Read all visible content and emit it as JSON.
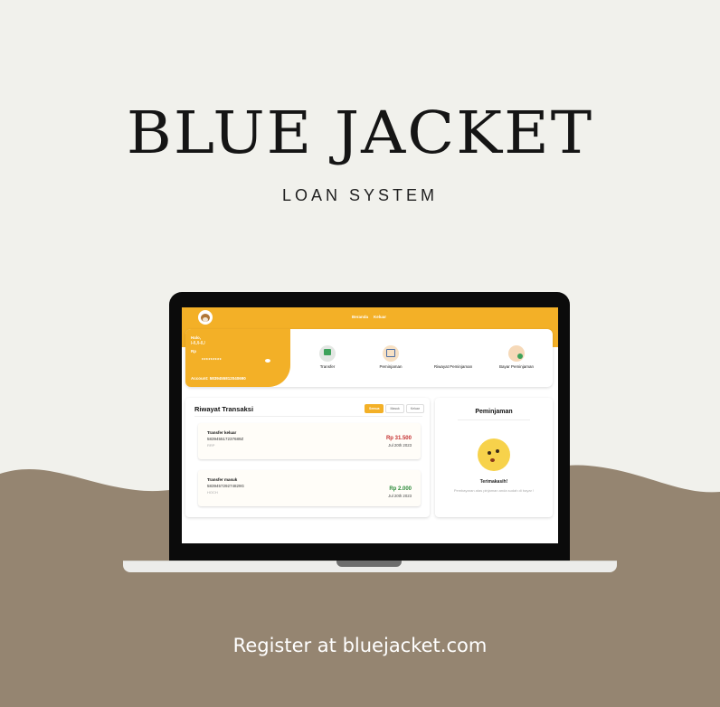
{
  "poster": {
    "title": "BLUE JACKET",
    "subtitle": "LOAN SYSTEM",
    "register": "Register at bluejacket.com",
    "colors": {
      "background": "#f1f1ec",
      "wave": "#958571",
      "accent": "#f3b027"
    }
  },
  "app": {
    "nav": {
      "item1": "Beranda",
      "item2": "Keluar"
    },
    "balance": {
      "greeting": "Halo,",
      "name": "HUHU",
      "currency": "Rp",
      "masked": "*********",
      "account": "Account: 5839455812040690"
    },
    "menu": [
      {
        "label": "Transfer",
        "icon": "money-icon"
      },
      {
        "label": "Peminjaman",
        "icon": "phone-icon"
      },
      {
        "label": "Riwayat Peminjaman",
        "icon": "list-icon"
      },
      {
        "label": "Bayar Peminjaman",
        "icon": "pay-icon"
      }
    ],
    "history": {
      "title": "Riwayat Transaksi",
      "filters": [
        "Semua",
        "Masuk",
        "Keluar"
      ],
      "items": [
        {
          "type": "Transfer keluar",
          "number": "583945517237689Z",
          "code": "RRP",
          "amount": "Rp 31.500",
          "date": "Jul 20th 2023"
        },
        {
          "type": "Transfer masuk",
          "number": "583945729274829G",
          "code": "HOCH",
          "amount": "Rp 2.000",
          "date": "Jul 20th 2023"
        }
      ]
    },
    "loan": {
      "title": "Peminjaman",
      "thanks": "Terimakasih!",
      "info": "Pembayaran atas pinjaman anda sudah di bayar !"
    }
  }
}
